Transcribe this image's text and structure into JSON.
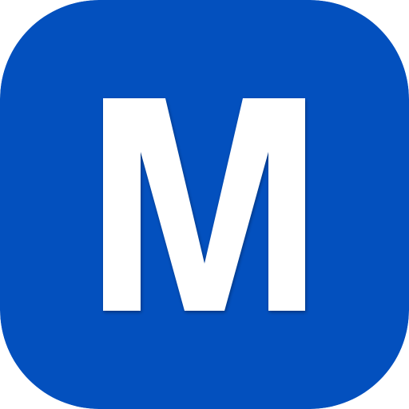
{
  "icon": {
    "letter": "M",
    "background_color": "#0350BE",
    "letter_color": "#FFFFFF"
  }
}
